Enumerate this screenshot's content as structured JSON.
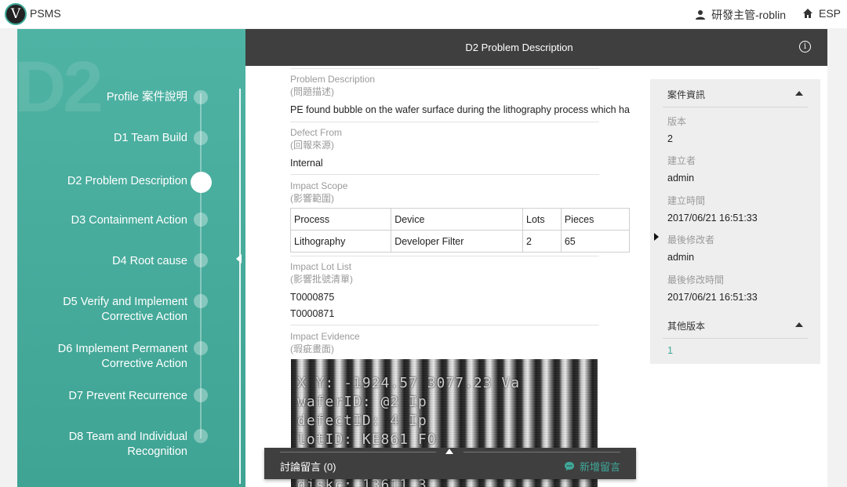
{
  "app": {
    "name": "PSMS",
    "logo_letter": "V"
  },
  "header": {
    "user": "研發主管-roblin",
    "lang": "ESP"
  },
  "sidebar": {
    "watermark": "D2",
    "steps": [
      {
        "code": "",
        "label": "Profile 案件說明"
      },
      {
        "code": "D1",
        "label": "Team Build"
      },
      {
        "code": "D2",
        "label": "Problem Description"
      },
      {
        "code": "D3",
        "label": "Containment Action"
      },
      {
        "code": "D4",
        "label": "Root cause"
      },
      {
        "code": "D5",
        "label": "Verify and Implement",
        "label2": "Corrective Action"
      },
      {
        "code": "D6",
        "label": "Implement Permanent",
        "label2": "Corrective Action"
      },
      {
        "code": "D7",
        "label": "Prevent Recurrence"
      },
      {
        "code": "D8",
        "label": "Team and Individual",
        "label2": "Recognition"
      }
    ]
  },
  "content": {
    "title": "D2 Problem Description",
    "problem": {
      "label": "Problem Description",
      "label_zh": "(問題描述)",
      "value": "PE found bubble on the wafer surface during the lithography process which ha"
    },
    "defect": {
      "label": "Defect From",
      "label_zh": "(回報來源)",
      "value": "Internal"
    },
    "impact_scope": {
      "label": "Impact Scope",
      "label_zh": "(影響範圍)",
      "headers": [
        "Process",
        "Device",
        "Lots",
        "Pieces"
      ],
      "rows": [
        [
          "Lithography",
          "Developer Filter",
          "2",
          "65"
        ]
      ]
    },
    "lot_list": {
      "label": "Impact Lot List",
      "label_zh": "(影響批號清單)",
      "items": [
        "T0000875",
        "T0000871"
      ]
    },
    "evidence": {
      "label": "Impact Evidence",
      "label_zh": "(瑕疵畫面)",
      "overlay": [
        "X Y: -1924.57  3077.23   Va",
        "waferID: @2            Ip",
        "defectID: 4            Ip",
        "lotID: KE861           FO",
        "",
        "diskc: 13611  3"
      ]
    }
  },
  "panel": {
    "title": "案件資訊",
    "fields": [
      {
        "label": "版本",
        "value": "2"
      },
      {
        "label": "建立者",
        "value": "admin"
      },
      {
        "label": "建立時間",
        "value": "2017/06/21 16:51:33"
      },
      {
        "label": "最後修改者",
        "value": "admin"
      },
      {
        "label": "最後修改時間",
        "value": "2017/06/21 16:51:33"
      }
    ],
    "other_versions_title": "其他版本",
    "other_versions": [
      "1"
    ]
  },
  "comments": {
    "label": "討論留言 (0)",
    "add_label": "新增留言"
  },
  "colors": {
    "accent": "#3ea99a",
    "header_dark": "#3f3f3f"
  }
}
